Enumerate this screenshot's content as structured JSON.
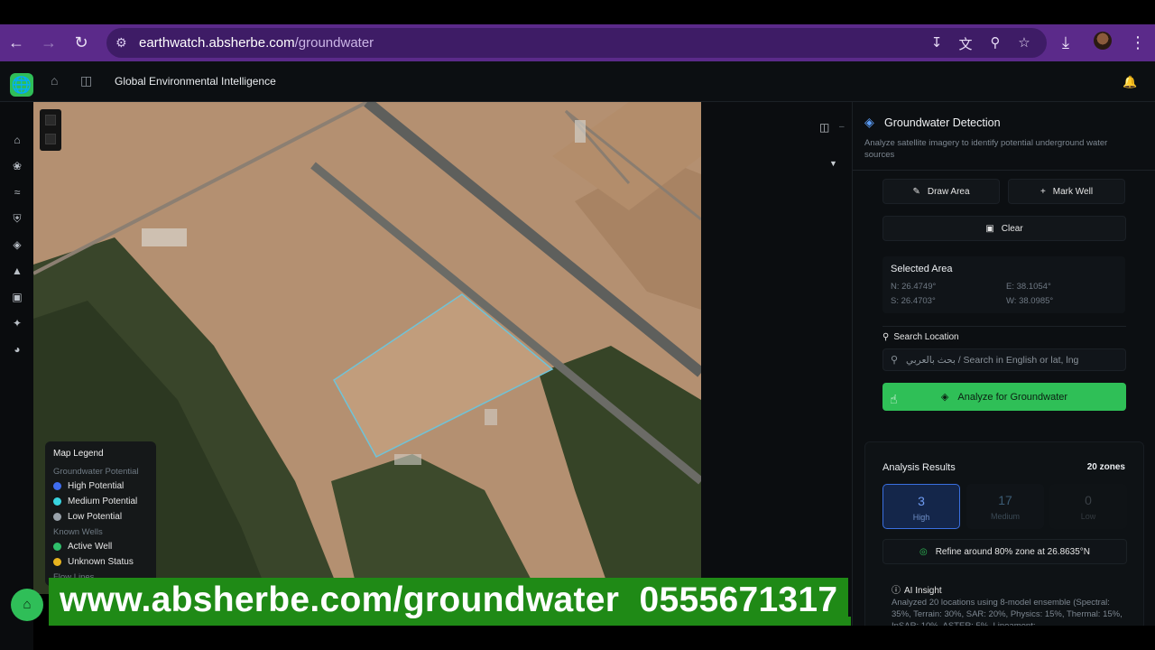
{
  "browser": {
    "url_host": "earthwatch.absherbe.com",
    "url_path": "/groundwater"
  },
  "header": {
    "title": "Global Environmental Intelligence"
  },
  "legend": {
    "title": "Map Legend",
    "groundwater_section": "Groundwater Potential",
    "high": "High Potential",
    "medium": "Medium Potential",
    "low": "Low Potential",
    "wells_section": "Known Wells",
    "active": "Active Well",
    "unknown": "Unknown Status",
    "flow_section": "Flow Lines",
    "colors": {
      "high": "#3f6df0",
      "medium": "#38d4e0",
      "low": "#9aa3ab",
      "active": "#2fbf6b",
      "unknown": "#e8b41f"
    }
  },
  "panel": {
    "title": "Groundwater Detection",
    "description": "Analyze satellite imagery to identify potential underground water sources",
    "draw_area": "Draw Area",
    "mark_well": "Mark Well",
    "clear": "Clear",
    "selected_area": {
      "title": "Selected Area",
      "n": "N: 26.4749°",
      "e": "E: 38.1054°",
      "s": "S: 26.4703°",
      "w": "W: 38.0985°"
    },
    "search": {
      "label": "Search Location",
      "placeholder": "بحث بالعربي / Search in English or lat, lng"
    },
    "analyze": "Analyze for Groundwater",
    "results": {
      "title": "Analysis Results",
      "count": "20 zones",
      "high_count": "3",
      "high_label": "High",
      "medium_count": "17",
      "medium_label": "Medium",
      "low_count": "0",
      "low_label": "Low",
      "refine": "Refine around 80% zone at 26.8635°N"
    },
    "insight": {
      "title": "AI Insight",
      "text": "Analyzed 20 locations using 8-model ensemble (Spectral: 35%, Terrain: 30%, SAR: 20%, Physics: 15%, Thermal: 15%, InSAR: 10%, ASTER: 5%, Lineament:"
    }
  },
  "banner": {
    "text": "www.absherbe.com/groundwater  0555671317"
  }
}
